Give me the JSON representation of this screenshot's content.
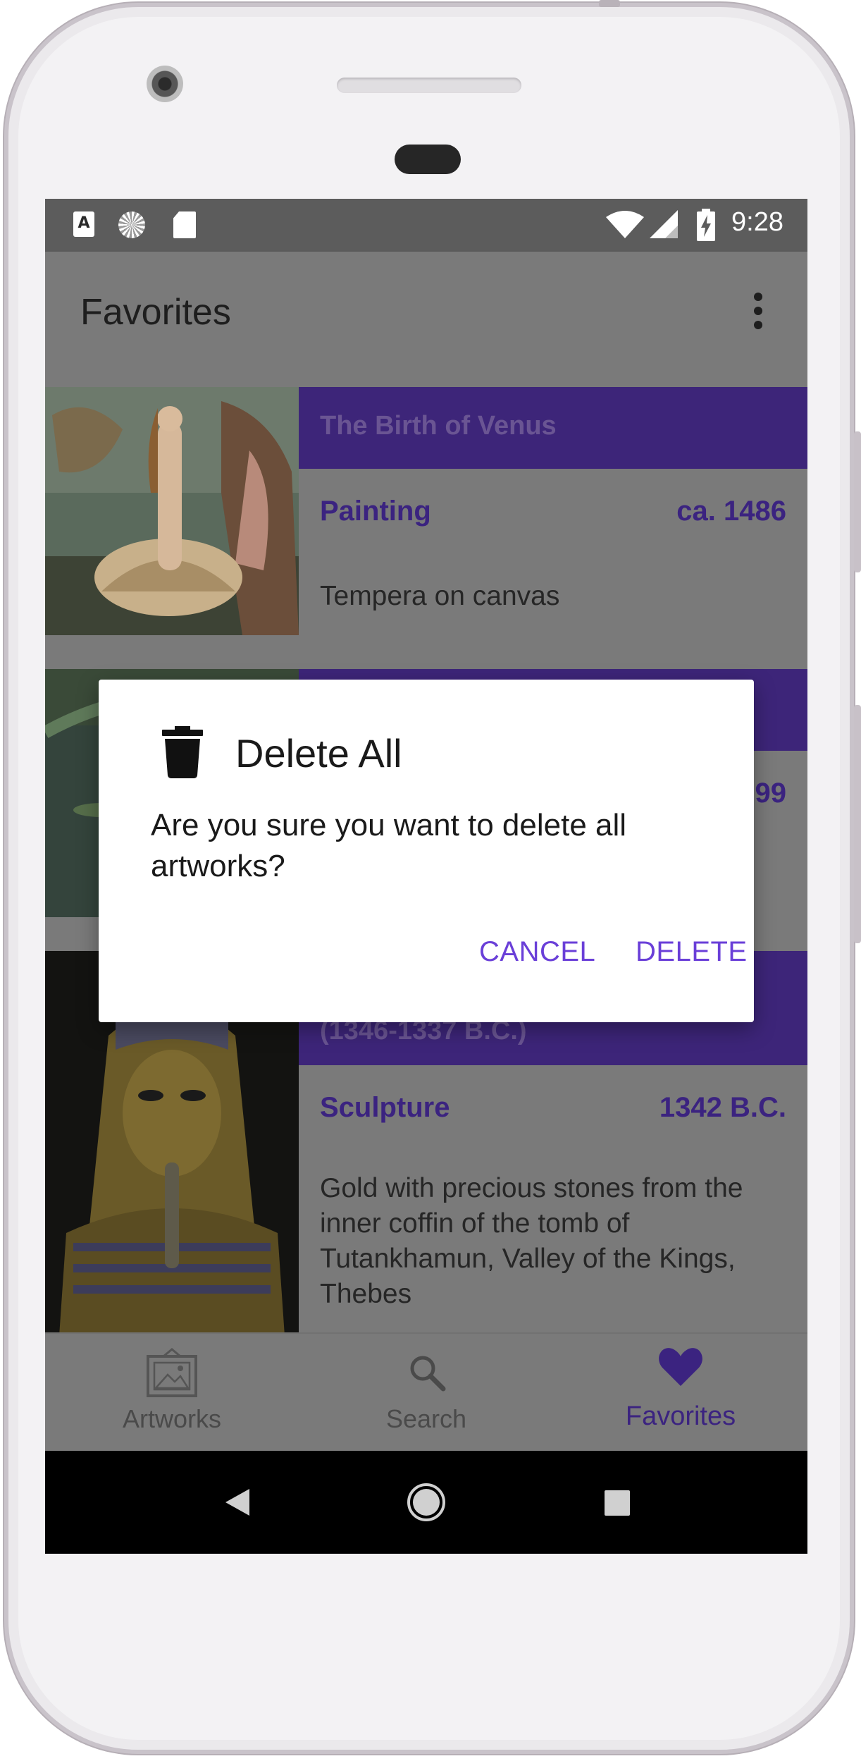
{
  "status_bar": {
    "time": "9:28",
    "left_icons": [
      "keyboard-a-icon",
      "sync-icon",
      "sd-card-icon"
    ],
    "right_icons": [
      "wifi-icon",
      "signal-icon",
      "battery-charging-icon"
    ]
  },
  "app_bar": {
    "title": "Favorites",
    "menu_icon": "overflow-menu-icon"
  },
  "cards": [
    {
      "title": "The Birth of Venus",
      "kind": "Painting",
      "date": "ca. 1486",
      "medium": "Tempera on canvas"
    },
    {
      "title": "",
      "kind": "",
      "date": "99",
      "medium": ""
    },
    {
      "title": "(1346-1337 B.C.)",
      "kind": "Sculpture",
      "date": "1342 B.C.",
      "medium": "Gold with precious stones from the inner coffin of the tomb of Tutankhamun, Valley of the Kings, Thebes"
    }
  ],
  "bottom_nav": {
    "items": [
      {
        "label": "Artworks",
        "icon": "framed-picture-icon",
        "active": false
      },
      {
        "label": "Search",
        "icon": "search-icon",
        "active": false
      },
      {
        "label": "Favorites",
        "icon": "heart-icon",
        "active": true
      }
    ]
  },
  "dialog": {
    "icon": "trash-icon",
    "title": "Delete All",
    "message": "Are you sure you want to delete all artworks?",
    "cancel_label": "CANCEL",
    "delete_label": "DELETE"
  },
  "colors": {
    "accent": "#6a3fd8",
    "header_purple": "#3d2579",
    "scrim_gray": "#7a7a7a"
  }
}
